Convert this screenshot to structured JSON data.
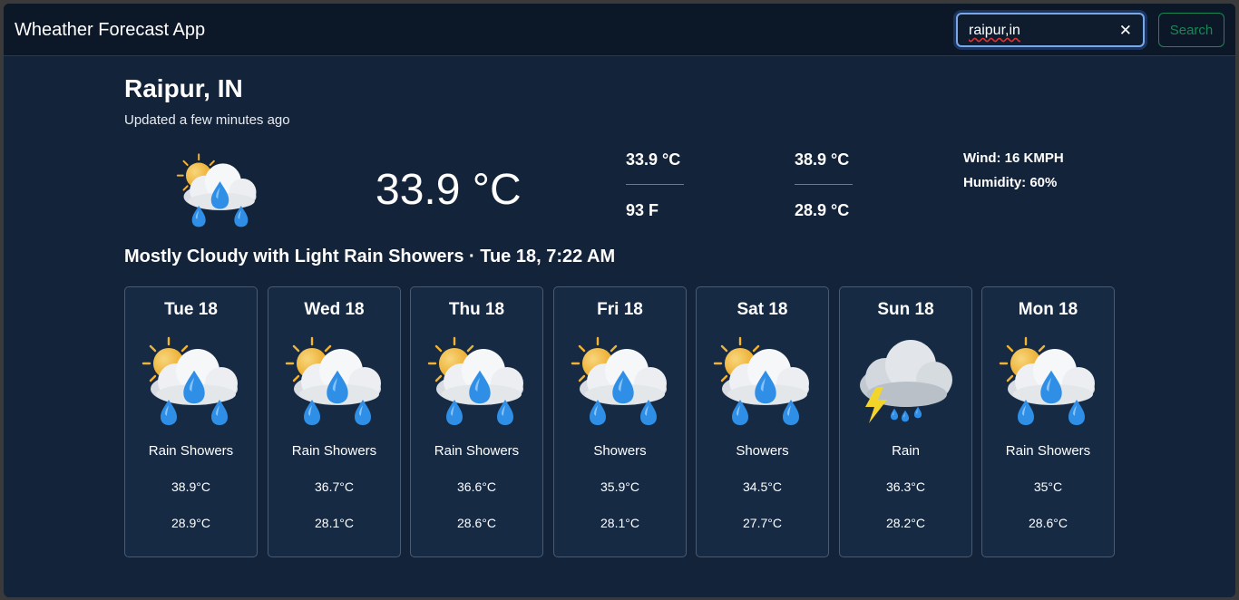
{
  "app": {
    "title": "Wheather Forecast App"
  },
  "search": {
    "value": "raipur,in",
    "button_label": "Search"
  },
  "current": {
    "location": "Raipur, IN",
    "updated": "Updated a few minutes ago",
    "temperature": "33.9 °C",
    "col1_top": "33.9 °C",
    "col1_bottom": "93 F",
    "col2_top": "38.9 °C",
    "col2_bottom": "28.9 °C",
    "wind": "Wind: 16 KMPH",
    "humidity": "Humidity: 60%",
    "summary": "Mostly Cloudy with Light Rain Showers · Tue 18, 7:22 AM",
    "icon": "sun-cloud-rain-icon"
  },
  "forecast": [
    {
      "day": "Tue 18",
      "condition": "Rain Showers",
      "high": "38.9°C",
      "low": "28.9°C",
      "icon": "sun-cloud-rain-icon"
    },
    {
      "day": "Wed 18",
      "condition": "Rain Showers",
      "high": "36.7°C",
      "low": "28.1°C",
      "icon": "sun-cloud-rain-icon"
    },
    {
      "day": "Thu 18",
      "condition": "Rain Showers",
      "high": "36.6°C",
      "low": "28.6°C",
      "icon": "sun-cloud-rain-icon"
    },
    {
      "day": "Fri 18",
      "condition": "Showers",
      "high": "35.9°C",
      "low": "28.1°C",
      "icon": "sun-cloud-rain-icon"
    },
    {
      "day": "Sat 18",
      "condition": "Showers",
      "high": "34.5°C",
      "low": "27.7°C",
      "icon": "sun-cloud-rain-icon"
    },
    {
      "day": "Sun 18",
      "condition": "Rain",
      "high": "36.3°C",
      "low": "28.2°C",
      "icon": "storm-cloud-icon"
    },
    {
      "day": "Mon 18",
      "condition": "Rain Showers",
      "high": "35°C",
      "low": "28.6°C",
      "icon": "sun-cloud-rain-icon"
    }
  ],
  "colors": {
    "background": "#13233a",
    "navbar": "#0c1828",
    "card": "#162a44",
    "search_accent": "#198754"
  }
}
